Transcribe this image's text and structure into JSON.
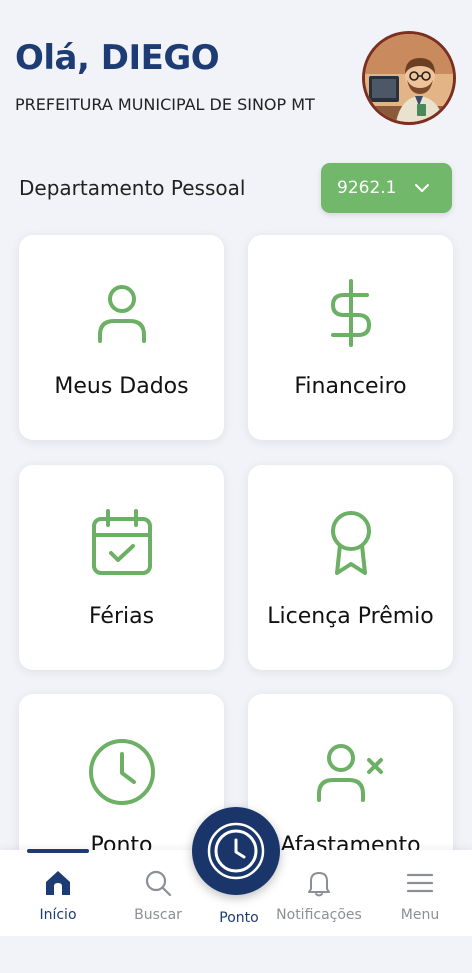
{
  "header": {
    "greeting": "Olá, DIEGO",
    "organization": "PREFEITURA MUNICIPAL DE SINOP MT"
  },
  "department": {
    "label": "Departamento Pessoal",
    "selected_value": "9262.1"
  },
  "cards": [
    {
      "label": "Meus Dados",
      "icon": "user-icon"
    },
    {
      "label": "Financeiro",
      "icon": "dollar-icon"
    },
    {
      "label": "Férias",
      "icon": "calendar-check-icon"
    },
    {
      "label": "Licença Prêmio",
      "icon": "award-icon"
    },
    {
      "label": "Ponto",
      "icon": "clock-icon"
    },
    {
      "label": "Afastamento",
      "icon": "user-x-icon"
    }
  ],
  "nav": {
    "items": [
      {
        "label": "Início",
        "icon": "home-icon",
        "active": true
      },
      {
        "label": "Buscar",
        "icon": "search-icon",
        "active": false
      },
      {
        "label": "Ponto",
        "icon": "clock-icon",
        "active": false
      },
      {
        "label": "Notificações",
        "icon": "bell-icon",
        "active": false
      },
      {
        "label": "Menu",
        "icon": "menu-icon",
        "active": false
      }
    ]
  },
  "colors": {
    "primary": "#1d3c74",
    "accent_green": "#71b86a",
    "background": "#f1f3f8"
  }
}
